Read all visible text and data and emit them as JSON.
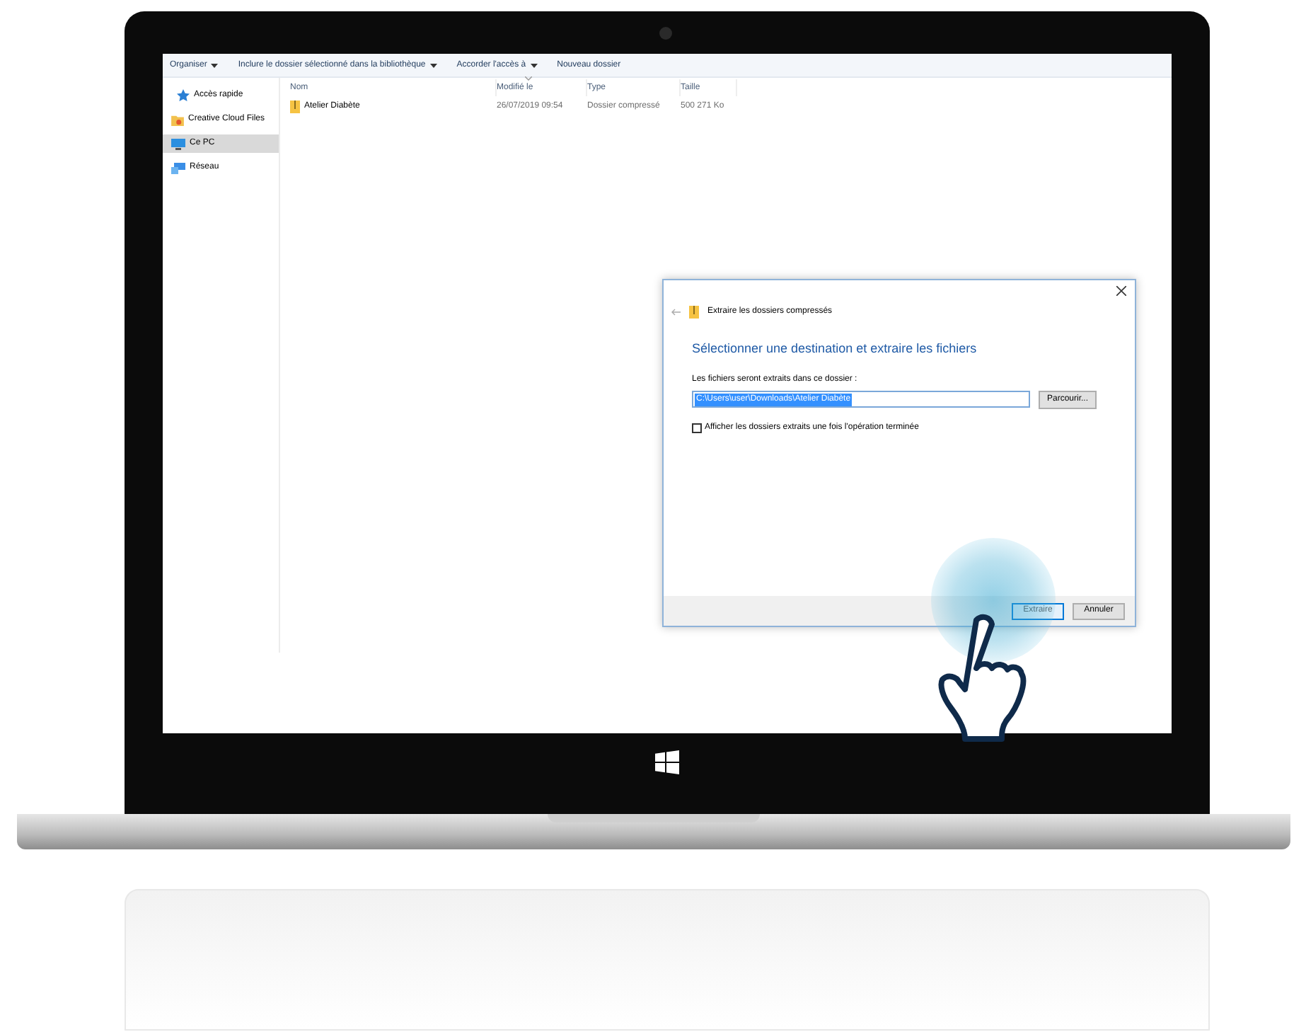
{
  "toolbar": [
    {
      "label": "Organiser",
      "dropdown": true
    },
    {
      "label": "Inclure le dossier sélectionné dans la bibliothèque",
      "dropdown": true
    },
    {
      "label": "Accorder l'accès à",
      "dropdown": true
    },
    {
      "label": "Nouveau dossier",
      "dropdown": false
    }
  ],
  "sidebar": {
    "items": [
      {
        "label": "Accès rapide",
        "selected": false
      },
      {
        "label": "Creative Cloud Files",
        "selected": false
      },
      {
        "label": "Ce PC",
        "selected": true
      },
      {
        "label": "Réseau",
        "selected": false
      }
    ]
  },
  "file_list": {
    "columns": [
      "Nom",
      "Modifié le",
      "Type",
      "Taille"
    ],
    "rows": [
      {
        "cells": [
          "Atelier Diabète",
          "26/07/2019 09:54",
          "Dossier compressé",
          "500 271 Ko"
        ]
      }
    ]
  },
  "dialog": {
    "title": "Extraire les dossiers compressés",
    "heading": "Sélectionner une destination et extraire les fichiers",
    "field_label": "Les fichiers seront extraits dans ce dossier :",
    "path": {
      "value": "C:\\Users\\user\\Downloads\\Atelier Diabète",
      "selected": true
    },
    "browse_button": "Parcourir...",
    "checkbox": {
      "label": "Afficher les dossiers extraits une fois l'opération terminée",
      "checked": false
    },
    "buttons": [
      {
        "label": "Extraire",
        "kind": "primary"
      },
      {
        "label": "Annuler",
        "kind": "secondary"
      }
    ]
  }
}
